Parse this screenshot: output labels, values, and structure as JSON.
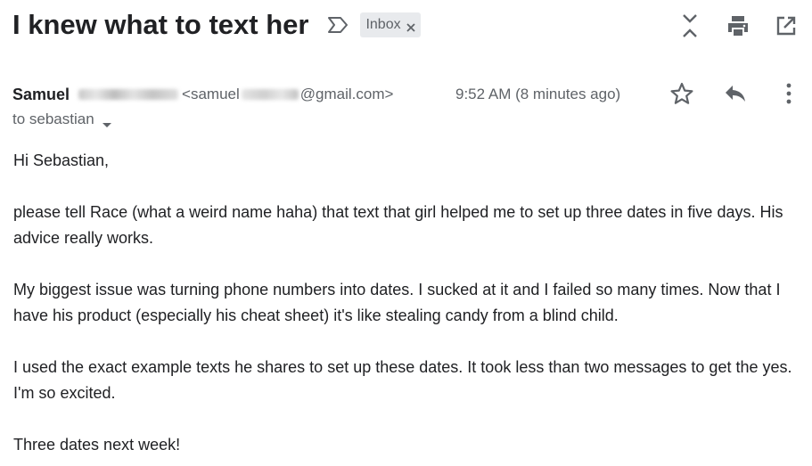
{
  "email": {
    "subject": "I knew what to text her",
    "label": "Inbox",
    "icons": {
      "importance": "importance-marker-icon",
      "label_remove": "close-icon",
      "collapse": "collapse-all-icon",
      "print": "print-icon",
      "open_new_window": "open-in-new-window-icon",
      "star": "star-icon",
      "reply": "reply-icon",
      "more": "more-vertical-icon",
      "recipients_caret": "caret-down-icon"
    },
    "sender": {
      "name": "Samuel",
      "email_prefix": "<samuel",
      "email_suffix": "@gmail.com>"
    },
    "time": "9:52 AM (8 minutes ago)",
    "recipients": "to sebastian",
    "body": [
      "Hi Sebastian,",
      "please tell Race (what a weird name haha) that text that girl helped me to set up three dates in five days. His advice really works.",
      "My biggest issue was turning phone numbers into dates. I sucked at it and I failed so many times. Now that I have his product (especially his cheat sheet) it's like stealing candy from a blind child.",
      "I used the exact example texts he shares to set up these dates. It took less than two messages to get the yes. I'm so excited.",
      "Three dates next week!"
    ],
    "colors": {
      "text": "#202124",
      "secondary": "#5f6368",
      "chip_bg": "#e8eaed",
      "icon": "#5f6368"
    }
  }
}
